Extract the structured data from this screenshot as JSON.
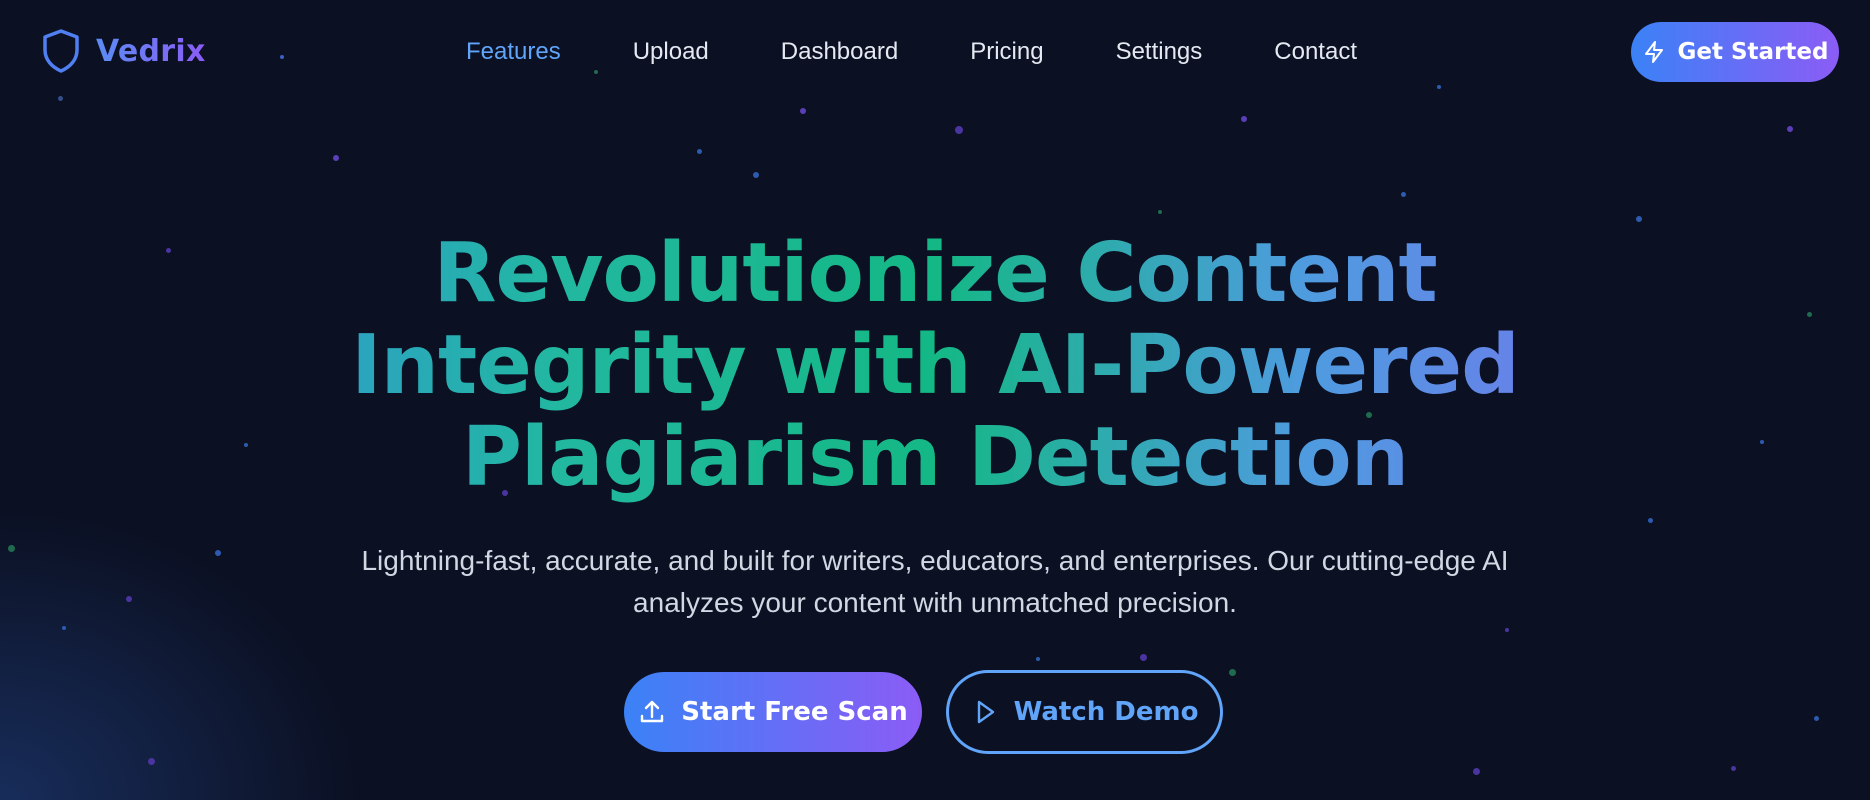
{
  "brand": {
    "name": "Vedrix",
    "icon": "shield-icon"
  },
  "nav": {
    "items": [
      {
        "label": "Features",
        "active": true
      },
      {
        "label": "Upload",
        "active": false
      },
      {
        "label": "Dashboard",
        "active": false
      },
      {
        "label": "Pricing",
        "active": false
      },
      {
        "label": "Settings",
        "active": false
      },
      {
        "label": "Contact",
        "active": false
      }
    ],
    "cta": {
      "label": "Get Started",
      "icon": "lightning-icon"
    }
  },
  "hero": {
    "title_lines": [
      "Revolutionize Content",
      "Integrity with AI-Powered",
      "Plagiarism Detection"
    ],
    "subtitle": "Lightning-fast, accurate, and built for writers, educators, and enterprises. Our cutting-edge AI analyzes your content with unmatched precision.",
    "primary_button": {
      "label": "Start Free Scan",
      "icon": "upload-icon"
    },
    "secondary_button": {
      "label": "Watch Demo",
      "icon": "play-icon"
    }
  },
  "colors": {
    "background": "#0b1022",
    "accent_blue": "#3b82f6",
    "accent_purple": "#8b5cf6",
    "accent_green": "#14b885",
    "link_active": "#60a5fa"
  }
}
